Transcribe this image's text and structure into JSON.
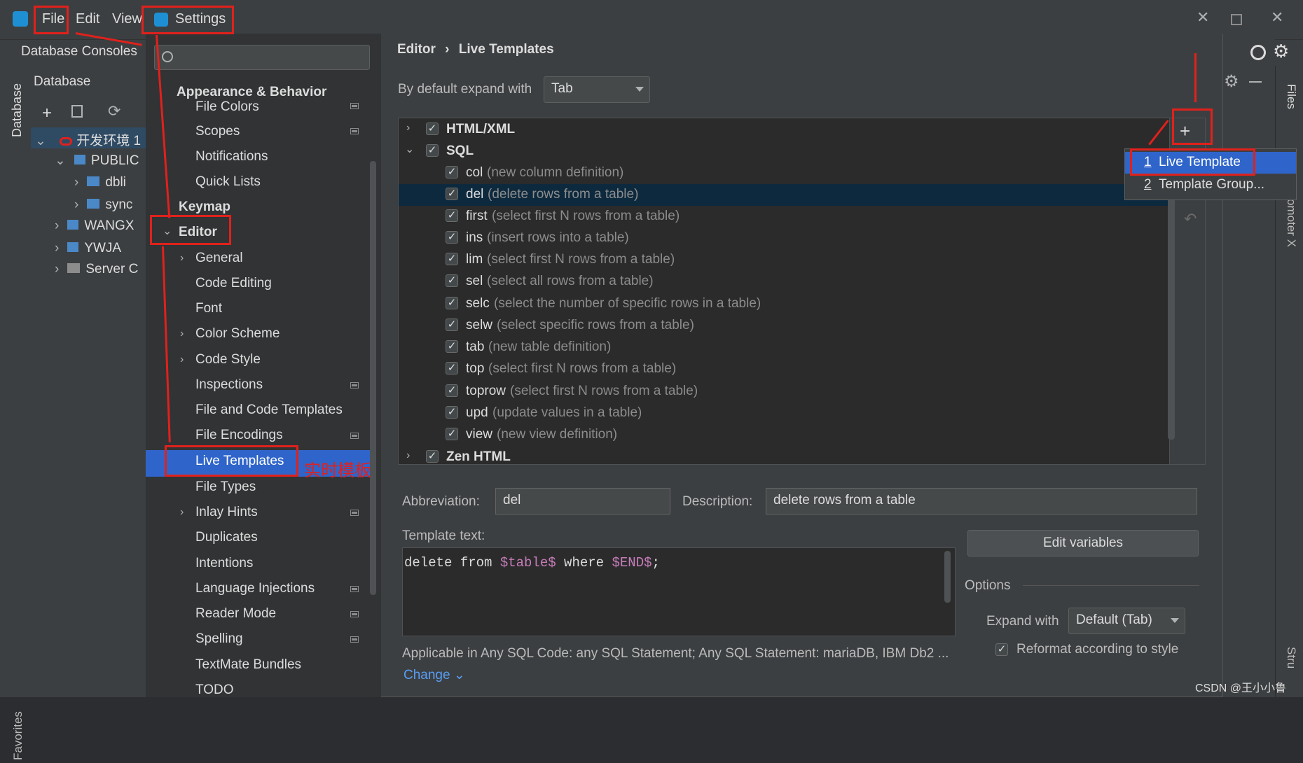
{
  "menubar": {
    "file": "File",
    "edit": "Edit",
    "view": "View"
  },
  "navbar": {
    "breadcrumb": "Database Consoles"
  },
  "database_panel": {
    "title": "Database",
    "tab_label": "Database",
    "tree": [
      {
        "label": "开发环境",
        "suffix": "1"
      },
      {
        "label": "PUBLIC"
      },
      {
        "label": "dbli"
      },
      {
        "label": "sync"
      },
      {
        "label": "WANGX"
      },
      {
        "label": "YWJA"
      },
      {
        "label": "Server C"
      }
    ],
    "favorites": "Favorites"
  },
  "right_strip": {
    "files": "Files",
    "promoter": "omoter X",
    "structure": "Stru"
  },
  "dialog": {
    "title": "Settings",
    "breadcrumb_parent": "Editor",
    "breadcrumb_sep": "›",
    "breadcrumb_current": "Live Templates"
  },
  "sidebar": {
    "search_placeholder": "",
    "section_appearance": "Appearance & Behavior",
    "items_top": [
      "File Colors",
      "Scopes",
      "Notifications",
      "Quick Lists"
    ],
    "keymap": "Keymap",
    "editor": "Editor",
    "editor_items": [
      "General",
      "Code Editing",
      "Font",
      "Color Scheme",
      "Code Style",
      "Inspections",
      "File and Code Templates",
      "File Encodings",
      "Live Templates",
      "File Types",
      "Inlay Hints",
      "Duplicates",
      "Intentions",
      "Language Injections",
      "Reader Mode",
      "Spelling",
      "TextMate Bundles",
      "TODO"
    ],
    "annotation": "实时模板"
  },
  "expand": {
    "label": "By default expand with",
    "value": "Tab"
  },
  "groups": {
    "html_xml": "HTML/XML",
    "sql": "SQL",
    "zen_html": "Zen HTML"
  },
  "templates": [
    {
      "name": "col",
      "desc": "(new column definition)"
    },
    {
      "name": "del",
      "desc": "(delete rows from a table)"
    },
    {
      "name": "first",
      "desc": "(select first N rows from a table)"
    },
    {
      "name": "ins",
      "desc": "(insert rows into a table)"
    },
    {
      "name": "lim",
      "desc": "(select first N rows from a table)"
    },
    {
      "name": "sel",
      "desc": "(select all rows from a table)"
    },
    {
      "name": "selc",
      "desc": "(select the number of specific rows in a table)"
    },
    {
      "name": "selw",
      "desc": "(select specific rows from a table)"
    },
    {
      "name": "tab",
      "desc": "(new table definition)"
    },
    {
      "name": "top",
      "desc": "(select first N rows from a table)"
    },
    {
      "name": "toprow",
      "desc": "(select first N rows from a table)"
    },
    {
      "name": "upd",
      "desc": "(update values in a table)"
    },
    {
      "name": "view",
      "desc": "(new view definition)"
    }
  ],
  "popup": {
    "item1_num": "1",
    "item1": "Live Template",
    "item2_num": "2",
    "item2": "Template Group..."
  },
  "editor_form": {
    "abbreviation_label": "Abbreviation:",
    "abbreviation": "del",
    "description_label": "Description:",
    "description": "delete rows from a table",
    "template_text_label": "Template text:",
    "code_1": "delete from ",
    "code_var1": "$table$",
    "code_2": " where ",
    "code_var2": "$END$",
    "code_3": ";",
    "edit_variables": "Edit variables",
    "options_label": "Options",
    "expand_with_label": "Expand with",
    "expand_with_value": "Default (Tab)",
    "reformat_label": "Reformat according to style",
    "applicable": "Applicable in Any SQL Code: any SQL Statement; Any SQL Statement: mariaDB, IBM Db2 ...",
    "change": "Change"
  },
  "watermark": "CSDN @王小小鲁",
  "colors": {
    "selection": "#0d293e",
    "popup_selected": "#2f65ca",
    "annotation_red": "#e0211c",
    "accent_blue": "#589df6"
  }
}
